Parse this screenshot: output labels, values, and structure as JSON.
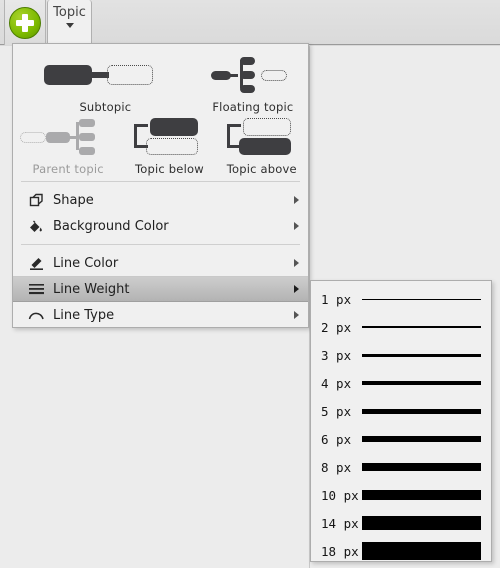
{
  "toolbar": {
    "add_button_icon": "plus-circle-icon",
    "tab_label": "Topic",
    "tab_caret_icon": "caret-down-icon"
  },
  "menu": {
    "gallery": [
      {
        "label": "Subtopic",
        "icon": "subtopic-icon",
        "disabled": false
      },
      {
        "label": "Floating topic",
        "icon": "floating-topic-icon",
        "disabled": false
      },
      {
        "label": "Parent topic",
        "icon": "parent-topic-icon",
        "disabled": true
      },
      {
        "label": "Topic below",
        "icon": "topic-below-icon",
        "disabled": false
      },
      {
        "label": "Topic above",
        "icon": "topic-above-icon",
        "disabled": false
      }
    ],
    "items": [
      {
        "label": "Shape",
        "icon": "shape-cube-icon",
        "selected": false,
        "has_submenu": true
      },
      {
        "label": "Background Color",
        "icon": "paint-bucket-icon",
        "selected": false,
        "has_submenu": true
      },
      {
        "label": "Line Color",
        "icon": "pen-underline-icon",
        "selected": false,
        "has_submenu": true
      },
      {
        "label": "Line Weight",
        "icon": "line-weight-icon",
        "selected": true,
        "has_submenu": true
      },
      {
        "label": "Line Type",
        "icon": "line-curve-icon",
        "selected": false,
        "has_submenu": true
      }
    ]
  },
  "submenu": {
    "title": "Line Weight",
    "options": [
      {
        "label": "1 px",
        "weight": 1
      },
      {
        "label": "2 px",
        "weight": 2
      },
      {
        "label": "3 px",
        "weight": 3
      },
      {
        "label": "4 px",
        "weight": 4
      },
      {
        "label": "5 px",
        "weight": 5
      },
      {
        "label": "6 px",
        "weight": 6
      },
      {
        "label": "8 px",
        "weight": 8
      },
      {
        "label": "10 px",
        "weight": 10
      },
      {
        "label": "14 px",
        "weight": 14
      },
      {
        "label": "18 px",
        "weight": 18
      }
    ]
  },
  "colors": {
    "accent_green": "#7cb900",
    "menu_bg": "#f0f0f0",
    "selected_row": "#c0c0c0",
    "node_solid": "#3e3e41",
    "disabled_text": "#9b9b9b",
    "line_swatch": "#000000"
  }
}
